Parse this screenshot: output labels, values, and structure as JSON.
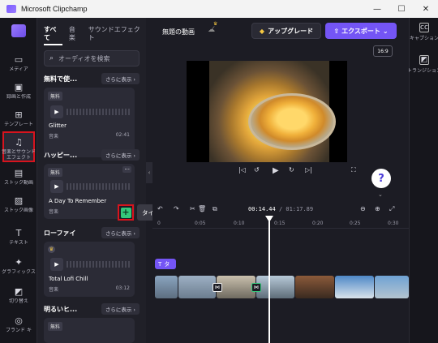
{
  "window": {
    "title": "Microsoft Clipchamp",
    "minimize": "—",
    "maximize": "☐",
    "close": "✕"
  },
  "nav": {
    "items": [
      {
        "label": "メディア",
        "icon": "folder-icon"
      },
      {
        "label": "録画と作成",
        "icon": "record-icon"
      },
      {
        "label": "テンプレート",
        "icon": "template-icon"
      },
      {
        "label": "音楽とサウンドエフェクト",
        "icon": "music-icon"
      },
      {
        "label": "ストック動画",
        "icon": "stock-video-icon"
      },
      {
        "label": "ストック画像",
        "icon": "stock-image-icon"
      },
      {
        "label": "テキスト",
        "icon": "text-icon"
      },
      {
        "label": "グラフィックス",
        "icon": "graphics-icon"
      },
      {
        "label": "切り替え",
        "icon": "transition-icon"
      },
      {
        "label": "ブランド キ",
        "icon": "brand-kit-icon"
      }
    ]
  },
  "panel": {
    "tabs": [
      "すべて",
      "音楽",
      "サウンドエフェクト"
    ],
    "search_placeholder": "オーディオを検索",
    "sections": [
      {
        "title": "無料で使...",
        "more": "さらに表示 ›"
      },
      {
        "title": "ハッピー...",
        "more": "さらに表示 ›"
      },
      {
        "title": "ローファイ",
        "more": "さらに表示 ›"
      },
      {
        "title": "明るいヒ...",
        "more": "さらに表示 ›"
      }
    ],
    "cards": [
      {
        "badge": "無料",
        "name": "Glitter",
        "kind": "音楽",
        "duration": "02:41"
      },
      {
        "badge": "無料",
        "name": "A Day To Remember",
        "kind": "音楽",
        "duration": "0"
      },
      {
        "badge": "",
        "name": "Total Lofi Chill",
        "kind": "音楽",
        "duration": "03:12"
      },
      {
        "badge": "無料",
        "name": "",
        "kind": "",
        "duration": ""
      }
    ]
  },
  "tooltip": "タイムラインに追加",
  "header": {
    "project_name": "無題の動画",
    "upgrade": "アップグレード",
    "export": "エクスポート",
    "ratio": "16:9"
  },
  "timeline": {
    "current": "00:14.44",
    "total": "/ 01:17.89",
    "ticks": [
      "0",
      "0:05",
      "0:10",
      "0:15",
      "0:20",
      "0:25",
      "0:30"
    ],
    "text_clip_label": "タ"
  },
  "rightbar": {
    "captions": "キャプション",
    "transitions": "トランジション"
  },
  "colors": {
    "accent": "#7455f5",
    "highlight_red": "#d7141e",
    "add_green": "#34c77b",
    "bg_dark": "#1c1c24"
  }
}
